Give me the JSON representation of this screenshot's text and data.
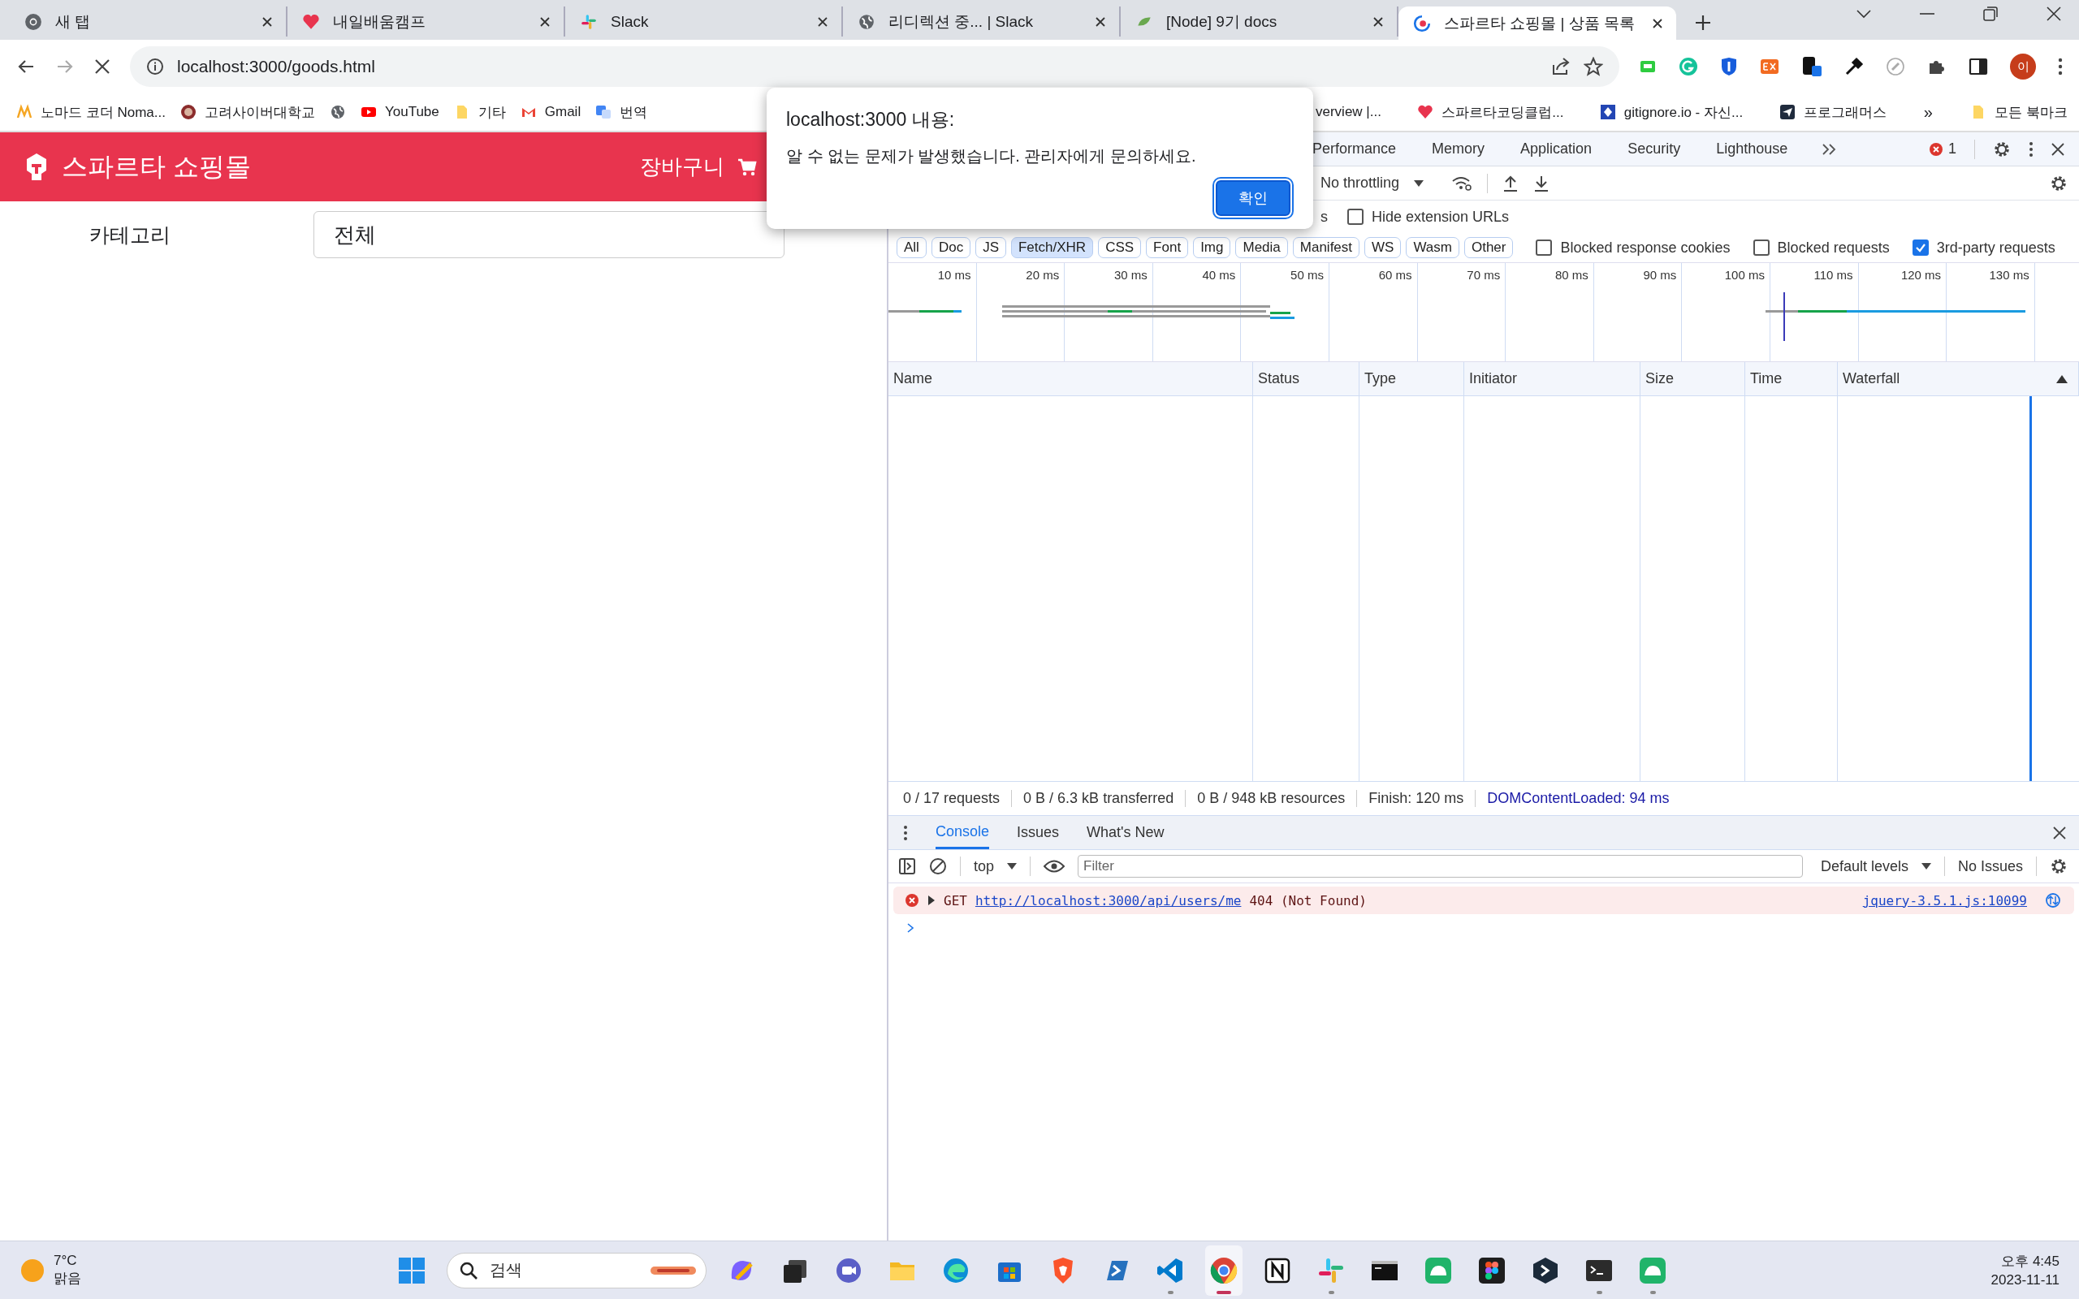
{
  "browser": {
    "tabs": [
      {
        "title": "새 탭",
        "kind": "chrome",
        "selected": false
      },
      {
        "title": "내일배움캠프",
        "kind": "heart",
        "selected": false
      },
      {
        "title": "Slack",
        "kind": "slack",
        "selected": false
      },
      {
        "title": "리디렉션 중... | Slack",
        "kind": "globe",
        "selected": false
      },
      {
        "title": "[Node] 9기 docs",
        "kind": "node",
        "selected": false
      },
      {
        "title": "스파르타 쇼핑몰 | 상품 목록",
        "kind": "loading",
        "selected": true
      }
    ],
    "address": "localhost:3000/goods.html",
    "profile_initial": "이",
    "bookmarks_left": [
      {
        "label": "노마드 코더 Noma...",
        "kind": "nomad"
      },
      {
        "label": "고려사이버대학교",
        "kind": "seal"
      },
      {
        "kind": "globe"
      },
      {
        "label": "YouTube",
        "kind": "youtube"
      },
      {
        "label": "기타",
        "kind": "folder"
      },
      {
        "label": "Gmail",
        "kind": "gmail"
      },
      {
        "label": "번역",
        "kind": "translate"
      }
    ],
    "bookmarks_right": [
      {
        "label": "verview |...",
        "kind": "none"
      },
      {
        "label": "스파르타코딩클럽...",
        "kind": "heart"
      },
      {
        "label": "gitignore.io - 자신...",
        "kind": "gitignore"
      },
      {
        "label": "프로그래머스",
        "kind": "programmers"
      }
    ],
    "bookmarks_overflow": "»",
    "all_bookmarks": "모든 북마크"
  },
  "page": {
    "brand": "스파르타 쇼핑몰",
    "cart": "장바구니",
    "category_label": "카테고리",
    "category_value": "전체"
  },
  "devtools": {
    "panels": [
      {
        "label": "Performance",
        "selected": false
      },
      {
        "label": "Memory",
        "selected": false
      },
      {
        "label": "Application",
        "selected": false
      },
      {
        "label": "Security",
        "selected": false
      },
      {
        "label": "Lighthouse",
        "selected": false
      }
    ],
    "error_count": "1",
    "throttling": "No throttling",
    "filter_fragment": "s",
    "filter_checks": [
      {
        "label": "Hide extension URLs",
        "checked": false
      }
    ],
    "chips": [
      {
        "label": "All",
        "selected": false
      },
      {
        "label": "Doc",
        "selected": false
      },
      {
        "label": "JS",
        "selected": false
      },
      {
        "label": "Fetch/XHR",
        "selected": true
      },
      {
        "label": "CSS",
        "selected": false
      },
      {
        "label": "Font",
        "selected": false
      },
      {
        "label": "Img",
        "selected": false
      },
      {
        "label": "Media",
        "selected": false
      },
      {
        "label": "Manifest",
        "selected": false
      },
      {
        "label": "WS",
        "selected": false
      },
      {
        "label": "Wasm",
        "selected": false
      },
      {
        "label": "Other",
        "selected": false
      }
    ],
    "chip_checks": [
      {
        "label": "Blocked response cookies",
        "checked": false
      },
      {
        "label": "Blocked requests",
        "checked": false
      },
      {
        "label": "3rd-party requests",
        "checked": true
      }
    ],
    "ticks": [
      "10 ms",
      "20 ms",
      "30 ms",
      "40 ms",
      "50 ms",
      "60 ms",
      "70 ms",
      "80 ms",
      "90 ms",
      "100 ms",
      "110 ms",
      "120 ms",
      "130 ms"
    ],
    "columns": [
      "Name",
      "Status",
      "Type",
      "Initiator",
      "Size",
      "Time",
      "Waterfall"
    ],
    "summary": [
      "0 / 17 requests",
      "0 B / 6.3 kB transferred",
      "0 B / 948 kB resources",
      "Finish: 120 ms"
    ],
    "dom_loaded": "DOMContentLoaded: 94 ms",
    "drawer_tabs": [
      {
        "label": "Console",
        "selected": true
      },
      {
        "label": "Issues",
        "selected": false
      },
      {
        "label": "What's New",
        "selected": false
      }
    ],
    "context": "top",
    "filter_placeholder": "Filter",
    "levels": "Default levels",
    "issues": "No Issues",
    "messages": [
      {
        "method": "GET",
        "url": "http://localhost:3000/api/users/me",
        "status": "404 (Not Found)",
        "source": "jquery-3.5.1.js:10099"
      }
    ]
  },
  "dialog": {
    "title": "localhost:3000 내용:",
    "message": "알 수 없는 문제가 발생했습니다. 관리자에게 문의하세요.",
    "button": "확인"
  },
  "taskbar": {
    "temperature": "7°C",
    "weather": "맑음",
    "search_placeholder": "검색",
    "time": "오후 4:45",
    "date": "2023-11-11",
    "apps": [
      {
        "kind": "start",
        "running": false,
        "selected": false
      },
      {
        "kind": "copilot",
        "running": false,
        "selected": false
      },
      {
        "kind": "taskview",
        "running": false,
        "selected": false
      },
      {
        "kind": "chat",
        "running": false,
        "selected": false
      },
      {
        "kind": "folder",
        "running": false,
        "selected": false
      },
      {
        "kind": "edge",
        "running": false,
        "selected": false
      },
      {
        "kind": "store",
        "running": false,
        "selected": false
      },
      {
        "kind": "lion",
        "running": false,
        "selected": false
      },
      {
        "kind": "shell",
        "running": false,
        "selected": false
      },
      {
        "kind": "vscode",
        "running": true,
        "selected": false
      },
      {
        "kind": "chrome",
        "running": true,
        "selected": true
      },
      {
        "kind": "notion",
        "running": false,
        "selected": false
      },
      {
        "kind": "slack",
        "running": true,
        "selected": false
      },
      {
        "kind": "cmd",
        "running": false,
        "selected": false
      },
      {
        "kind": "whale",
        "running": false,
        "selected": false
      },
      {
        "kind": "figma",
        "running": false,
        "selected": false
      },
      {
        "kind": "cube",
        "running": false,
        "selected": false
      },
      {
        "kind": "terminal",
        "running": true,
        "selected": false
      },
      {
        "kind": "whale",
        "running": true,
        "selected": false
      }
    ]
  }
}
